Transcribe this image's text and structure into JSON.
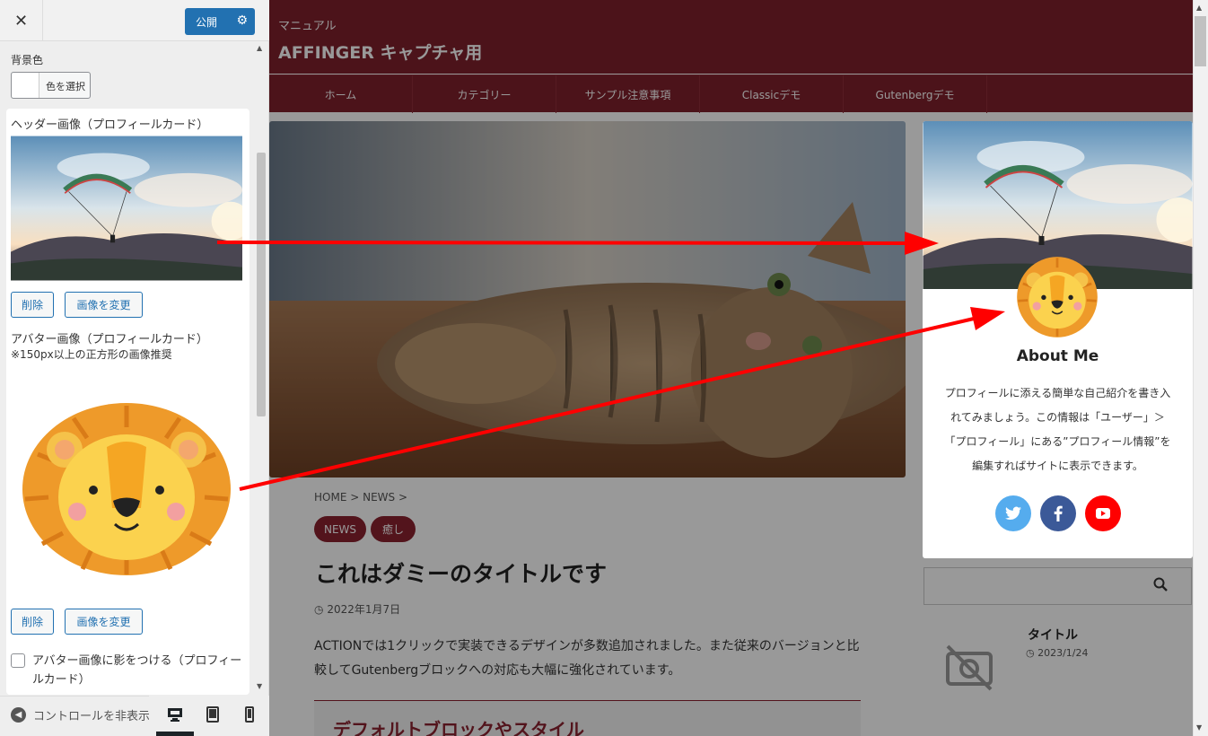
{
  "customizer": {
    "close_label": "✕",
    "publish_label": "公開",
    "bg_color_label": "背景色",
    "color_select_label": "色を選択",
    "header_image_label": "ヘッダー画像（プロフィールカード）",
    "delete_label": "削除",
    "change_image_label": "画像を変更",
    "avatar_label": "アバター画像（プロフィールカード）",
    "avatar_note": "※150px以上の正方形の画像推奨",
    "avatar_shadow_label": "アバター画像に影をつける（プロフィールカード）",
    "avatar_shadow_checked": false,
    "hide_controls_label": "コントロールを非表示",
    "devices": [
      "desktop-icon",
      "tablet-icon",
      "mobile-icon"
    ],
    "active_device": "desktop"
  },
  "site": {
    "tagline": "マニュアル",
    "title": "AFFINGER キャプチャ用",
    "nav": [
      "ホーム",
      "カテゴリー",
      "サンプル注意事項",
      "Classicデモ",
      "Gutenbergデモ"
    ],
    "brand_color": "#7f212c"
  },
  "post": {
    "breadcrumb": "HOME >  NEWS >",
    "tags": [
      "NEWS",
      "癒し"
    ],
    "title": "これはダミーのタイトルです",
    "date": "2022年1月7日",
    "body": "ACTIONでは1クリックで実装できるデザインが多数追加されました。また従来のバージョンと比較してGutenbergブロックへの対応も大幅に強化されています。",
    "h2": "デフォルトブロックやスタイル"
  },
  "profile": {
    "heading": "About Me",
    "bio": "プロフィールに添える簡単な自己紹介を書き入れてみましょう。この情報は「ユーザー」＞「プロフィール」にある”プロフィール情報”を編集すればサイトに表示できます。",
    "social": [
      {
        "name": "twitter-icon",
        "color": "#55acee"
      },
      {
        "name": "facebook-icon",
        "color": "#3b5998"
      },
      {
        "name": "youtube-icon",
        "color": "#ff0000"
      }
    ]
  },
  "widget": {
    "title": "タイトル",
    "date": "2023/1/24"
  },
  "annotation": {
    "arrow_color": "#ff0000"
  }
}
